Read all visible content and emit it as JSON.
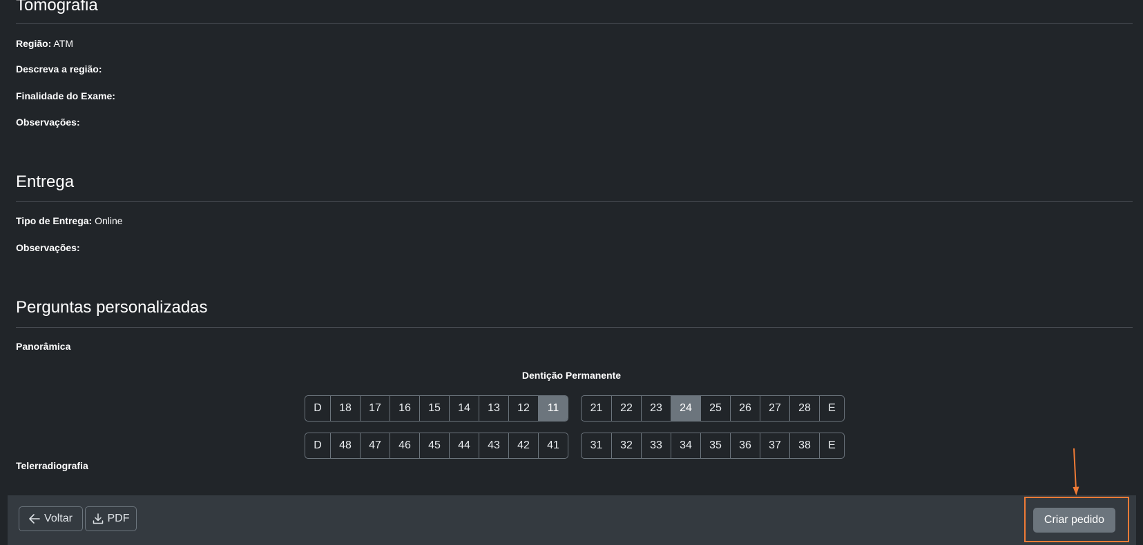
{
  "tomografia": {
    "title": "Tomografia",
    "fields": [
      {
        "label": "Região:",
        "value": "ATM"
      },
      {
        "label": "Descreva a região:",
        "value": ""
      },
      {
        "label": "Finalidade do Exame:",
        "value": ""
      },
      {
        "label": "Observações:",
        "value": ""
      }
    ]
  },
  "entrega": {
    "title": "Entrega",
    "fields": [
      {
        "label": "Tipo de Entrega:",
        "value": "Online"
      },
      {
        "label": "Observações:",
        "value": ""
      }
    ]
  },
  "perguntas": {
    "title": "Perguntas personalizadas",
    "panoramica": "Panorâmica",
    "telerradiografia": "Telerradiografia"
  },
  "denticao": {
    "title": "Dentição Permanente",
    "upper_right": [
      "D",
      "18",
      "17",
      "16",
      "15",
      "14",
      "13",
      "12",
      "11"
    ],
    "upper_left": [
      "21",
      "22",
      "23",
      "24",
      "25",
      "26",
      "27",
      "28",
      "E"
    ],
    "lower_right": [
      "D",
      "48",
      "47",
      "46",
      "45",
      "44",
      "43",
      "42",
      "41"
    ],
    "lower_left": [
      "31",
      "32",
      "33",
      "34",
      "35",
      "36",
      "37",
      "38",
      "E"
    ],
    "selected": [
      "11",
      "24"
    ]
  },
  "footer": {
    "back_label": "Voltar",
    "pdf_label": "PDF",
    "create_label": "Criar pedido"
  },
  "colors": {
    "background": "#212529",
    "footer": "#343a40",
    "selected_tooth": "#6c757d",
    "annotation": "#f07b36"
  }
}
